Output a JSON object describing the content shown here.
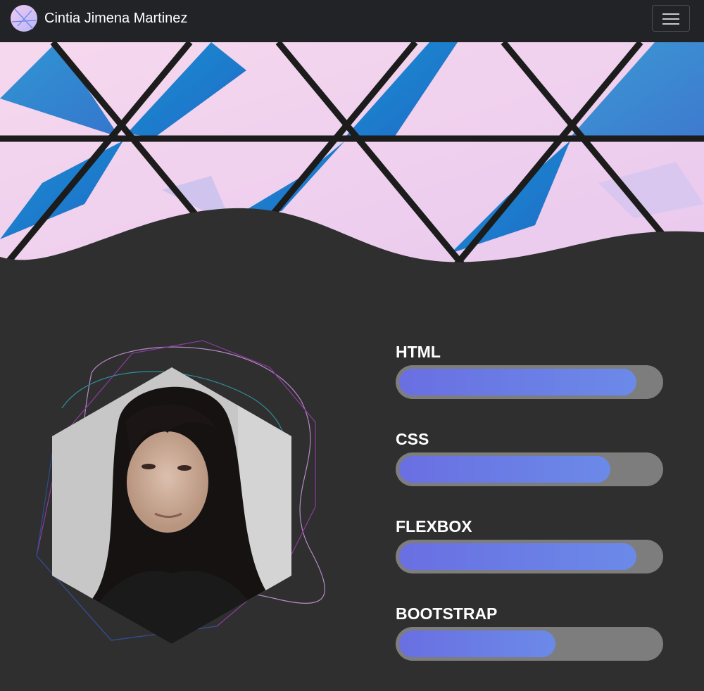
{
  "navbar": {
    "brand_name": "Cintia Jimena Martinez",
    "logo_icon": "brand-logo-icon",
    "menu_icon": "hamburger-menu-icon"
  },
  "hero": {
    "image": "geometric-triangles-banner"
  },
  "profile": {
    "image": "profile-photo-hexagon"
  },
  "skills": [
    {
      "name": "HTML",
      "level": 0.91
    },
    {
      "name": "CSS",
      "level": 0.81
    },
    {
      "name": "FLEXBOX",
      "level": 0.91
    },
    {
      "name": "BOOTSTRAP",
      "level": 0.6
    }
  ],
  "colors": {
    "navbar_bg": "#212327",
    "page_bg": "#2f2f2f",
    "bar_track": "#7d7d7d",
    "bar_fill_start": "#6a6fe2",
    "bar_fill_end": "#6b8ae8"
  }
}
